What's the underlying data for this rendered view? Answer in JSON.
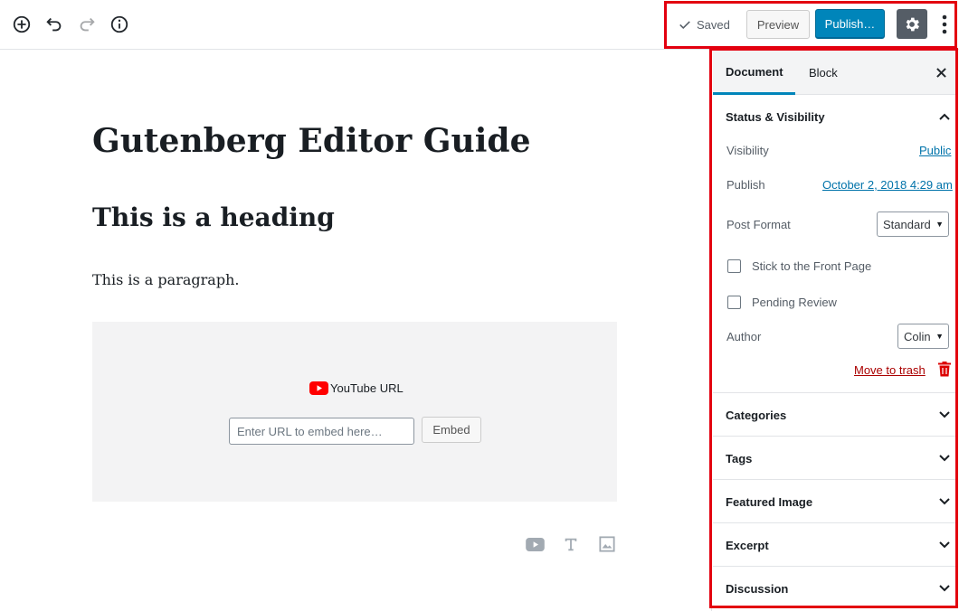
{
  "toolbar": {
    "saved_label": "Saved",
    "preview_label": "Preview",
    "publish_label": "Publish…"
  },
  "post": {
    "title": "Gutenberg Editor Guide",
    "heading": "This is a heading",
    "paragraph": "This is a paragraph."
  },
  "embed": {
    "label": "YouTube URL",
    "placeholder": "Enter URL to embed here…",
    "button_label": "Embed"
  },
  "sidebar": {
    "tabs": [
      {
        "label": "Document",
        "active": true
      },
      {
        "label": "Block",
        "active": false
      }
    ],
    "status_panel": {
      "title": "Status & Visibility",
      "visibility_label": "Visibility",
      "visibility_value": "Public",
      "publish_label": "Publish",
      "publish_value": "October 2, 2018 4:29 am",
      "post_format_label": "Post Format",
      "post_format_value": "Standard",
      "stick_label": "Stick to the Front Page",
      "pending_label": "Pending Review",
      "author_label": "Author",
      "author_value": "Colin",
      "trash_label": "Move to trash"
    },
    "panels": [
      "Categories",
      "Tags",
      "Featured Image",
      "Excerpt",
      "Discussion"
    ]
  },
  "colors": {
    "accent": "#0085ba",
    "highlight": "#e3000f",
    "youtube_red": "#ff0000",
    "trash": "#aa0000"
  }
}
